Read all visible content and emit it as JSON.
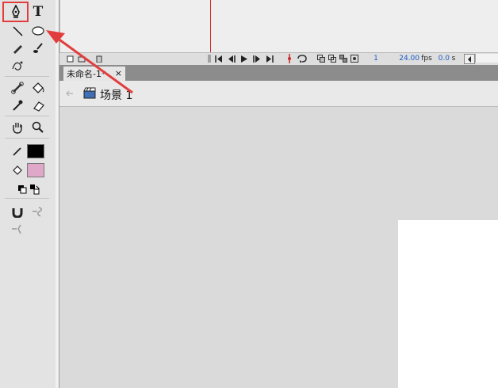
{
  "toolbox": {
    "tools": [
      {
        "name": "pen-icon"
      },
      {
        "name": "text-tool-icon",
        "label": "T"
      },
      {
        "name": "line-icon"
      },
      {
        "name": "oval-icon"
      },
      {
        "name": "pencil-icon"
      },
      {
        "name": "brush-icon"
      },
      {
        "name": "deco-icon"
      },
      {
        "name": "bone-icon"
      },
      {
        "name": "paint-bucket-icon"
      },
      {
        "name": "eyedropper-icon"
      },
      {
        "name": "eraser-icon"
      },
      {
        "name": "hand-icon"
      },
      {
        "name": "zoom-icon"
      },
      {
        "name": "stroke-color-icon"
      },
      {
        "name": "fill-color-icon"
      },
      {
        "name": "black-white-icon"
      },
      {
        "name": "swap-colors-icon"
      },
      {
        "name": "snap-magnet-icon"
      },
      {
        "name": "smooth-icon"
      },
      {
        "name": "straighten-icon"
      }
    ],
    "stroke_color": "#000000",
    "fill_color": "#e0a8c8"
  },
  "timeline": {
    "frame_number": "1",
    "fps": "24.00",
    "fps_unit": "fps",
    "time": "0.0",
    "time_unit": "s"
  },
  "document": {
    "tab_title": "未命名-1*",
    "tab_close": "×",
    "scene_label": "场景 1"
  },
  "colors": {
    "annotation_red": "#e23d3d",
    "blue_text": "#1b5ec9"
  }
}
